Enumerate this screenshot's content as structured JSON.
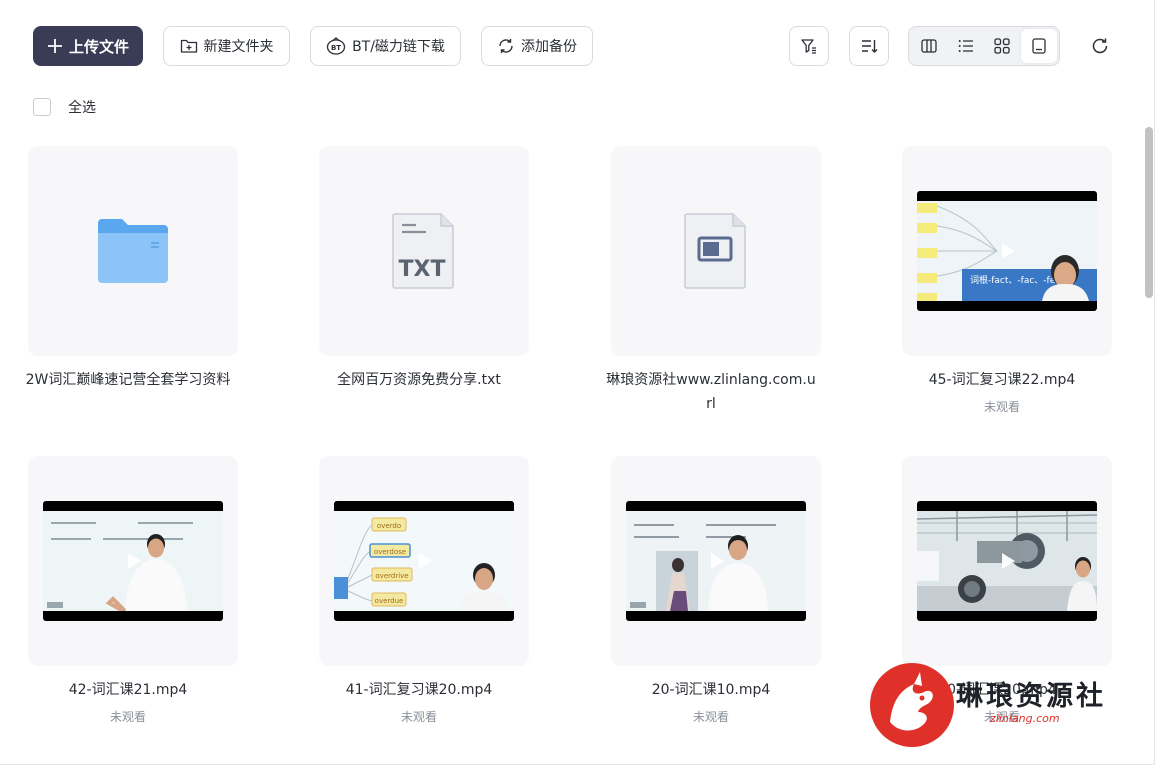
{
  "toolbar": {
    "upload_label": "上传文件",
    "new_folder_label": "新建文件夹",
    "bt_label": "BT/磁力链下载",
    "bt_icon_text": "BT",
    "backup_label": "添加备份"
  },
  "select_all_label": "全选",
  "files": [
    {
      "name": "2W词汇巅峰速记营全套学习资料",
      "type": "folder",
      "status": ""
    },
    {
      "name": "全网百万资源免费分享.txt",
      "type": "txt",
      "status": "",
      "icon_text": "TXT"
    },
    {
      "name": "琳琅资源社www.zlinlang.com.url",
      "type": "url",
      "status": ""
    },
    {
      "name": "45-词汇复习课22.mp4",
      "type": "video",
      "status": "未观看",
      "caption": "词根-fact、-fac、-fea"
    },
    {
      "name": "42-词汇课21.mp4",
      "type": "video",
      "status": "未观看"
    },
    {
      "name": "41-词汇复习课20.mp4",
      "type": "video",
      "status": "未观看",
      "bubbles": [
        "overdo",
        "overdose",
        "overdrive",
        "overdue"
      ]
    },
    {
      "name": "20-词汇课10.mp4",
      "type": "video",
      "status": "未观看"
    },
    {
      "name": "0-词汇课20.mp4",
      "type": "video",
      "status": "未观看"
    }
  ],
  "watermark": {
    "title": "琳琅资源社",
    "url": "zlinlang.com"
  },
  "colors": {
    "primary_button": "#3a3b55",
    "folder": "#7ab8f5",
    "card_bg": "#f7f7f9",
    "watermark_red": "#e0302a"
  }
}
